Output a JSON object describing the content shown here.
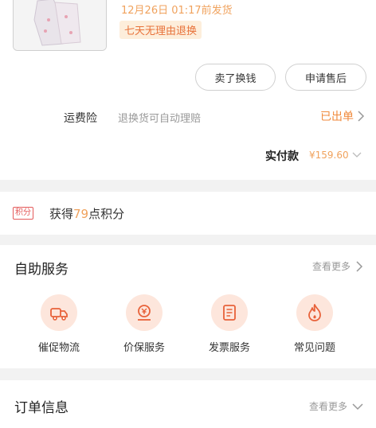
{
  "order": {
    "ship_time": "12月26日 01:17前发货",
    "return_badge": "七天无理由退换",
    "actions": {
      "buy_again": "卖了换钱",
      "after_sales": "申请售后"
    },
    "shipping_insurance": {
      "label": "运费险",
      "description": "退换货可自动理赔",
      "status": "已出单"
    },
    "payment": {
      "label": "实付款",
      "amount": "¥159.60"
    }
  },
  "points": {
    "badge": "积分",
    "prefix": "获得",
    "amount": "79",
    "suffix": "点积分"
  },
  "self_service": {
    "title": "自助服务",
    "see_more": "查看更多",
    "items": [
      {
        "label": "催促物流",
        "icon": "truck-icon"
      },
      {
        "label": "价保服务",
        "icon": "price-protect-icon"
      },
      {
        "label": "发票服务",
        "icon": "invoice-icon"
      },
      {
        "label": "常见问题",
        "icon": "flame-icon"
      }
    ]
  },
  "order_info": {
    "title": "订单信息",
    "see_more": "查看更多"
  },
  "colors": {
    "accent": "#f08a3c",
    "badge_bg": "#fdeedb",
    "icon_bg": "#fde6dc",
    "icon_fg": "#e8623a"
  }
}
